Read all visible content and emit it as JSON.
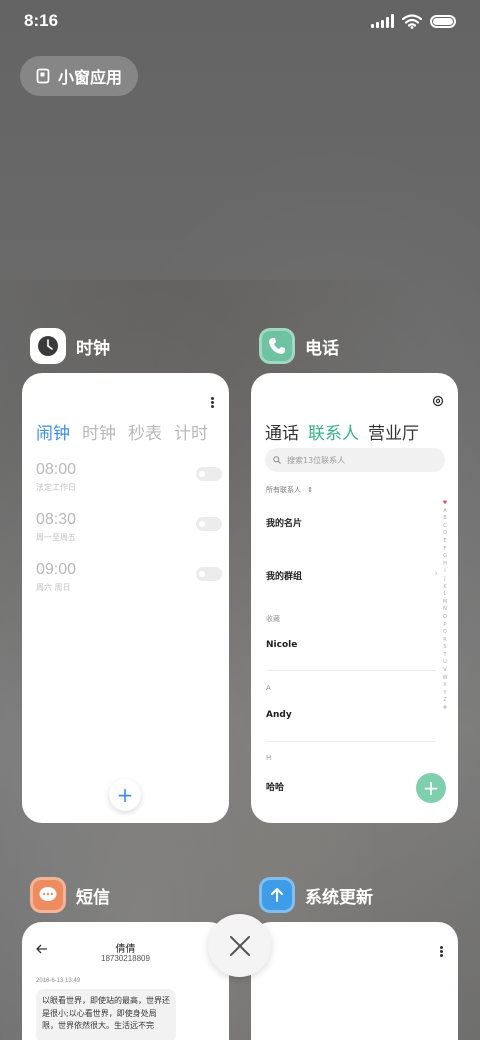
{
  "status_bar": {
    "time": "8:16"
  },
  "floating_window": {
    "label": "小窗应用"
  },
  "apps": {
    "clock": {
      "name": "时钟",
      "tabs": [
        "闹钟",
        "计时",
        "秒表",
        "计时"
      ],
      "tab_labels": {
        "alarm": "闹钟",
        "worldclock": "时钟",
        "stopwatch": "秒表",
        "timer": "计时"
      },
      "alarms": [
        {
          "time": "08:00",
          "sub": "法定工作日"
        },
        {
          "time": "08:30",
          "sub": "周一至周五"
        },
        {
          "time": "09:00",
          "sub": "周六 周日"
        }
      ],
      "add_label": "+"
    },
    "phone": {
      "name": "电话",
      "tabs": {
        "calls": "通话",
        "contacts": "联系人",
        "hall": "营业厅"
      },
      "search_placeholder": "搜索13位联系人",
      "contacts_header": "所有联系人",
      "my_card": "我的名片",
      "my_groups": "我的群组",
      "section_fav": "收藏",
      "contact_1": "Nicole",
      "section_a": "A",
      "contact_2": "Andy",
      "section_h": "H",
      "contact_3": "哈哈",
      "alphabet": [
        "♥",
        "A",
        "B",
        "C",
        "D",
        "E",
        "F",
        "G",
        "H",
        "I",
        "J",
        "K",
        "L",
        "M",
        "N",
        "O",
        "P",
        "Q",
        "R",
        "S",
        "T",
        "U",
        "V",
        "W",
        "X",
        "Y",
        "Z",
        "#"
      ],
      "add_label": "+"
    },
    "messages": {
      "name": "短信",
      "contact_name": "倩倩",
      "contact_number": "18730218809",
      "date": "2016-6-13 13:49",
      "message": "以眼看世界，即使站的最高，世界还是很小;以心看世界，即使身处局限，世界依然很大。生活远不完"
    },
    "updater": {
      "name": "系统更新"
    }
  },
  "colors": {
    "clock_accent": "#3b8fe6",
    "phone_accent": "#34b38a",
    "messages_icon": "#ee8c60",
    "updater_icon": "#3e9de6"
  }
}
